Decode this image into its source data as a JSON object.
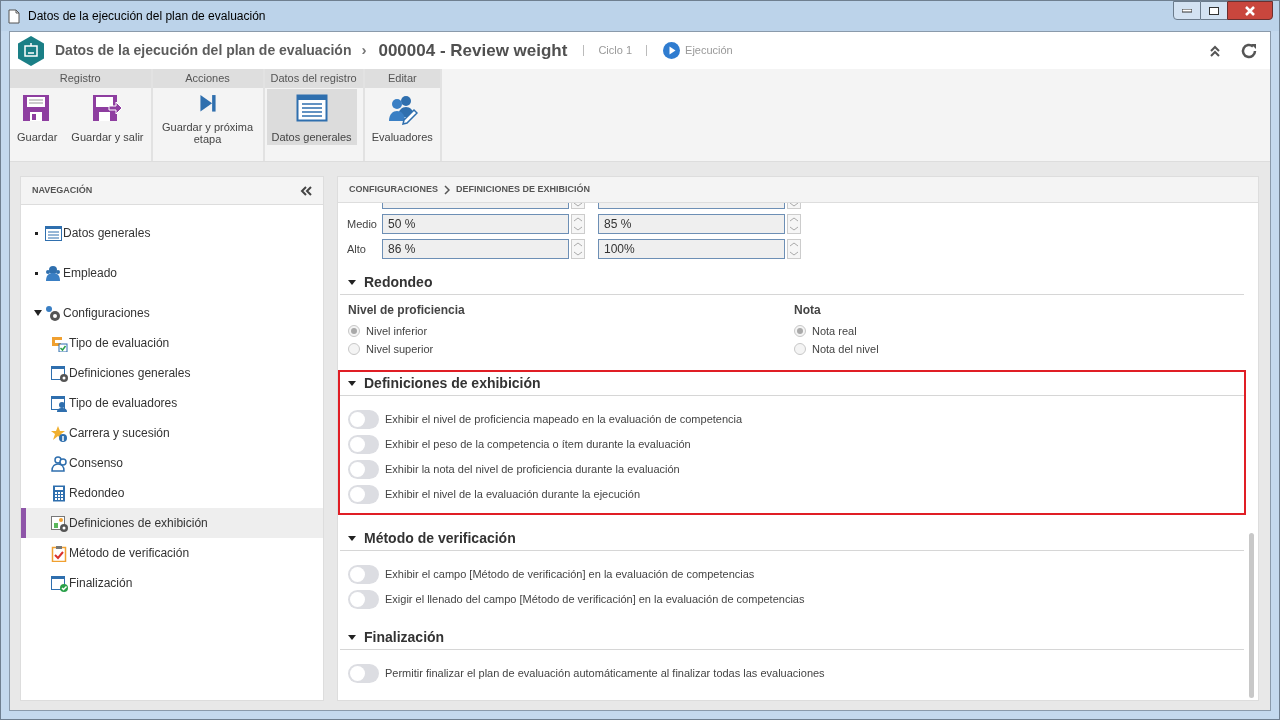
{
  "window": {
    "title": "Datos de la ejecución del plan de evaluación"
  },
  "header": {
    "section": "Datos de la ejecución del plan de evaluación",
    "separator": "›",
    "record": "000004 - Review weight",
    "cycle": "Ciclo 1",
    "status": "Ejecución"
  },
  "toolbar": {
    "groups": [
      {
        "label": "Registro",
        "buttons": [
          {
            "label": "Guardar",
            "selected": false
          },
          {
            "label": "Guardar y salir",
            "selected": false
          }
        ]
      },
      {
        "label": "Acciones",
        "buttons": [
          {
            "label": "Guardar y próxima etapa",
            "selected": false
          }
        ]
      },
      {
        "label": "Datos del registro",
        "buttons": [
          {
            "label": "Datos generales",
            "selected": true
          }
        ]
      },
      {
        "label": "Editar",
        "buttons": [
          {
            "label": "Evaluadores",
            "selected": false
          }
        ]
      }
    ]
  },
  "navigation": {
    "title": "NAVEGACIÓN",
    "items": [
      {
        "label": "Datos generales",
        "selected": false
      },
      {
        "label": "Empleado",
        "selected": false
      },
      {
        "label": "Configuraciones",
        "selected": false,
        "expanded": true,
        "children": [
          {
            "label": "Tipo de evaluación",
            "selected": false
          },
          {
            "label": "Definiciones generales",
            "selected": false
          },
          {
            "label": "Tipo de evaluadores",
            "selected": false
          },
          {
            "label": "Carrera y sucesión",
            "selected": false
          },
          {
            "label": "Consenso",
            "selected": false
          },
          {
            "label": "Redondeo",
            "selected": false
          },
          {
            "label": "Definiciones de exhibición",
            "selected": true
          },
          {
            "label": "Método de verificación",
            "selected": false
          },
          {
            "label": "Finalización",
            "selected": false
          }
        ]
      }
    ]
  },
  "breadcrumb": [
    "CONFIGURACIONES",
    "DEFINICIONES DE EXHIBICIÓN"
  ],
  "ranges": [
    {
      "label": "Medio",
      "from": "50 %",
      "to": "85 %"
    },
    {
      "label": "Alto",
      "from": "86 %",
      "to": "100%"
    }
  ],
  "sections": [
    {
      "title": "Redondeo",
      "kind": "radios",
      "highlighted": false,
      "groups": [
        {
          "title": "Nivel de proficiencia",
          "options": [
            {
              "label": "Nivel inferior",
              "selected": true
            },
            {
              "label": "Nivel superior",
              "selected": false
            }
          ]
        },
        {
          "title": "Nota",
          "options": [
            {
              "label": "Nota real",
              "selected": true
            },
            {
              "label": "Nota del nivel",
              "selected": false
            }
          ]
        }
      ]
    },
    {
      "title": "Definiciones de exhibición",
      "kind": "toggles",
      "highlighted": true,
      "toggles": [
        {
          "label": "Exhibir el nivel de proficiencia mapeado en la evaluación de competencia",
          "on": false
        },
        {
          "label": "Exhibir el peso de la competencia o ítem durante la evaluación",
          "on": false
        },
        {
          "label": "Exhibir la nota del nivel de proficiencia durante la evaluación",
          "on": false
        },
        {
          "label": "Exhibir el nivel de la evaluación durante la ejecución",
          "on": false
        }
      ]
    },
    {
      "title": "Método de verificación",
      "kind": "toggles",
      "highlighted": false,
      "toggles": [
        {
          "label": "Exhibir el campo [Método de verificación] en la evaluación de competencias",
          "on": false
        },
        {
          "label": "Exigir el llenado del campo [Método de verificación] en la evaluación de competencias",
          "on": false
        }
      ]
    },
    {
      "title": "Finalización",
      "kind": "toggles",
      "highlighted": false,
      "toggles": [
        {
          "label": "Permitir finalizar el plan de evaluación automáticamente al finalizar todas las evaluaciones",
          "on": false
        }
      ]
    }
  ]
}
